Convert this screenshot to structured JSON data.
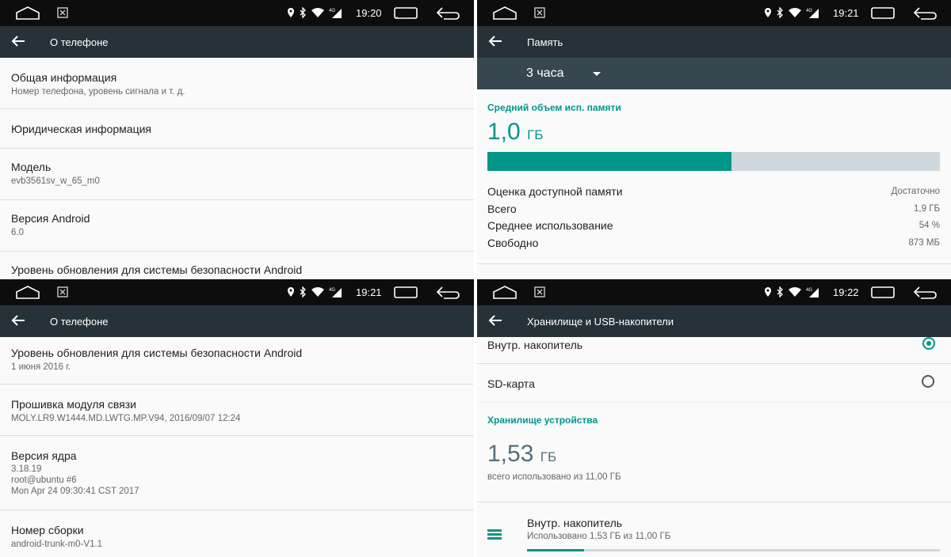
{
  "p1": {
    "status": {
      "time": "19:20"
    },
    "appbar": {
      "title": "О телефоне"
    },
    "items": [
      {
        "title": "Общая информация",
        "sub": "Номер телефона, уровень сигнала и т. д."
      },
      {
        "title": "Юридическая информация",
        "sub": ""
      },
      {
        "title": "Модель",
        "sub": "evb3561sv_w_65_m0"
      },
      {
        "title": "Версия Android",
        "sub": "6.0"
      },
      {
        "title": "Уровень обновления для системы безопасности Android",
        "sub": ""
      }
    ]
  },
  "p2": {
    "status": {
      "time": "19:21"
    },
    "appbar": {
      "title": "Память"
    },
    "spinner": {
      "value": "3 часа"
    },
    "section": "Средний объем исп. памяти",
    "amount": "1,0",
    "unit": "ГБ",
    "usage_fraction": 0.54,
    "rows": [
      {
        "label": "Оценка доступной памяти",
        "value": "Достаточно"
      },
      {
        "label": "Всего",
        "value": "1,9 ГБ"
      },
      {
        "label": "Среднее использование",
        "value": "54 %"
      },
      {
        "label": "Свободно",
        "value": "873 МБ"
      }
    ]
  },
  "p3": {
    "status": {
      "time": "19:21"
    },
    "appbar": {
      "title": "О телефоне"
    },
    "items": [
      {
        "title": "Уровень обновления для системы безопасности Android",
        "sub": "1 июня 2016 г."
      },
      {
        "title": "Прошивка модуля связи",
        "sub": "MOLY.LR9.W1444.MD.LWTG.MP.V94, 2016/09/07 12:24"
      },
      {
        "title": "Версия ядра",
        "sub1": "3.18.19",
        "sub2": "root@ubuntu #6",
        "sub3": "Mon Apr 24 09:30:41 CST 2017"
      },
      {
        "title": "Номер сборки",
        "sub": "android-trunk-m0-V1.1"
      }
    ]
  },
  "p4": {
    "status": {
      "time": "19:22"
    },
    "appbar": {
      "title": "Хранилище и USB-накопители"
    },
    "options": [
      {
        "label": "Внутр. накопитель",
        "selected": true
      },
      {
        "label": "SD-карта",
        "selected": false
      }
    ],
    "section": "Хранилище устройства",
    "amount": "1,53",
    "unit": "ГБ",
    "amount_sub": "всего использовано из 11,00 ГБ",
    "storage": {
      "title": "Внутр. накопитель",
      "sub": "Использовано 1,53 ГБ из 11,00 ГБ",
      "fraction": 0.139
    },
    "icon": "storage-list-icon"
  }
}
